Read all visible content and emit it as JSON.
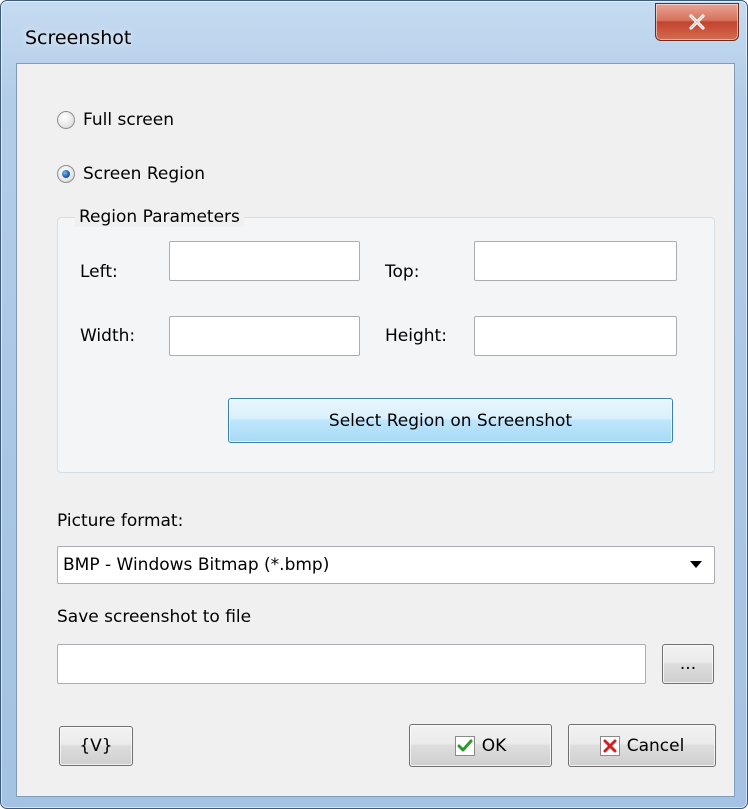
{
  "window": {
    "title": "Screenshot"
  },
  "capture_mode": {
    "options": [
      {
        "label": "Full screen",
        "checked": false
      },
      {
        "label": "Screen Region",
        "checked": true
      }
    ]
  },
  "region": {
    "group_title": "Region Parameters",
    "left_label": "Left:",
    "left_value": "",
    "top_label": "Top:",
    "top_value": "",
    "width_label": "Width:",
    "width_value": "",
    "height_label": "Height:",
    "height_value": "",
    "select_button_label": "Select Region on Screenshot"
  },
  "picture_format": {
    "label": "Picture format:",
    "selected": "BMP - Windows Bitmap (*.bmp)"
  },
  "save_file": {
    "label": "Save screenshot to file",
    "value": "",
    "browse_label": "..."
  },
  "footer": {
    "variables_label": "{V}",
    "ok_label": "OK",
    "cancel_label": "Cancel"
  },
  "icons": {
    "close": "close-icon",
    "ok": "checkmark-icon",
    "cancel": "cross-icon",
    "dropdown": "chevron-down-icon"
  },
  "colors": {
    "titlebar": "#b3cde8",
    "close_button": "#c2452e",
    "ok_check": "#2b9a2b",
    "cancel_cross": "#d21f1f",
    "primary_button": "#bee6fd"
  }
}
